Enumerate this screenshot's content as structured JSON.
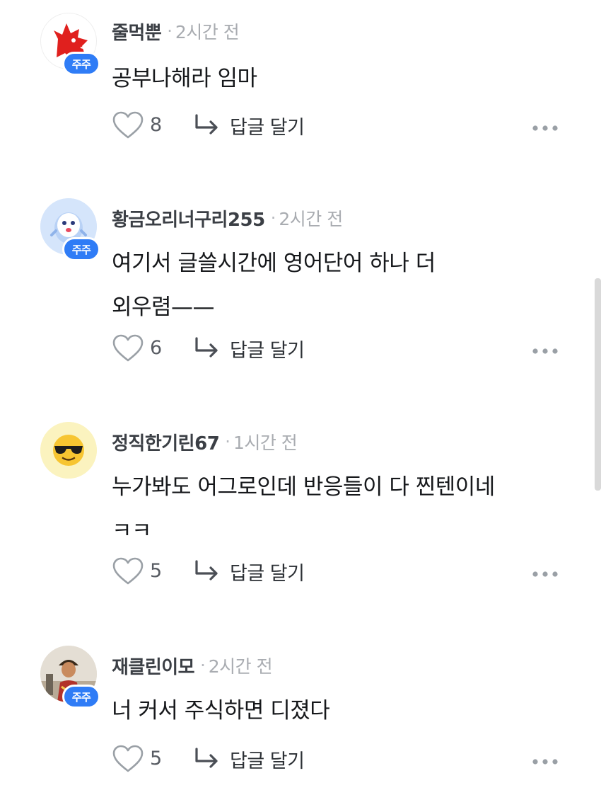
{
  "comments": [
    {
      "username": "줄먹뿐",
      "separator": "·",
      "time": "2시간 전",
      "badge": "주주",
      "avatar_icon": "red-dragon-icon",
      "lines": [
        "공부나해라 임마"
      ],
      "likes": "8",
      "reply_label": "답글 달기"
    },
    {
      "username": "황금오리너구리255",
      "separator": "·",
      "time": "2시간 전",
      "badge": "주주",
      "avatar_icon": "ghost-character-icon",
      "lines": [
        "여기서 글쓸시간에 영어단어 하나 더",
        "외우렴——"
      ],
      "likes": "6",
      "reply_label": "답글 달기"
    },
    {
      "username": "정직한기린67",
      "separator": "·",
      "time": "1시간 전",
      "badge": "",
      "avatar_icon": "sunglasses-face-icon",
      "lines": [
        "누가봐도 어그로인데 반응들이 다 찐텐이네",
        "ㅋㅋ"
      ],
      "likes": "5",
      "reply_label": "답글 달기"
    },
    {
      "username": "재클린이모",
      "separator": "·",
      "time": "2시간 전",
      "badge": "주주",
      "avatar_icon": "photo-avatar-icon",
      "lines": [
        "너 커서 주식하면 디졌다"
      ],
      "likes": "5",
      "reply_label": "답글 달기"
    }
  ],
  "colors": {
    "badge": "#2f7cf6",
    "username": "#3b3f45",
    "time": "#a9acb1",
    "text": "#16181b",
    "icon": "#9aa0a6"
  }
}
